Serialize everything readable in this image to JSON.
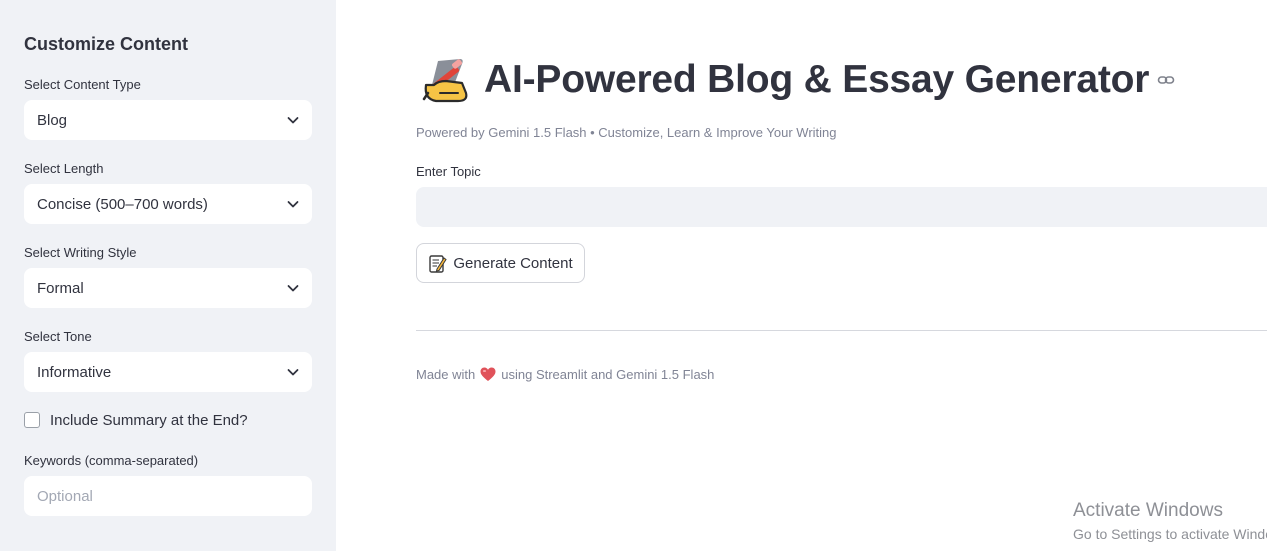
{
  "sidebar": {
    "title": "Customize Content",
    "content_type": {
      "label": "Select Content Type",
      "value": "Blog"
    },
    "length": {
      "label": "Select Length",
      "value": "Concise (500–700 words)"
    },
    "writing_style": {
      "label": "Select Writing Style",
      "value": "Formal"
    },
    "tone": {
      "label": "Select Tone",
      "value": "Informative"
    },
    "summary_checkbox": {
      "label": "Include Summary at the End?",
      "checked": false
    },
    "keywords": {
      "label": "Keywords (comma-separated)",
      "value": "",
      "placeholder": "Optional"
    }
  },
  "main": {
    "title_icon": "writing-hand-icon",
    "title": "AI-Powered Blog & Essay Generator",
    "subtitle": "Powered by Gemini 1.5 Flash • Customize, Learn & Improve Your Writing",
    "topic": {
      "label": "Enter Topic",
      "value": "",
      "placeholder": ""
    },
    "generate_button": {
      "icon": "memo-icon",
      "label": "Generate Content"
    },
    "footer": {
      "prefix": "Made with",
      "icon": "heart-icon",
      "suffix": "using Streamlit and Gemini 1.5 Flash"
    }
  },
  "watermark": {
    "title": "Activate Windows",
    "subtitle": "Go to Settings to activate Windows."
  },
  "colors": {
    "sidebar_bg": "#f0f2f6",
    "text": "#31333f",
    "muted_text": "#808495",
    "input_bg": "#f0f2f6",
    "heart": "#e0525a"
  }
}
